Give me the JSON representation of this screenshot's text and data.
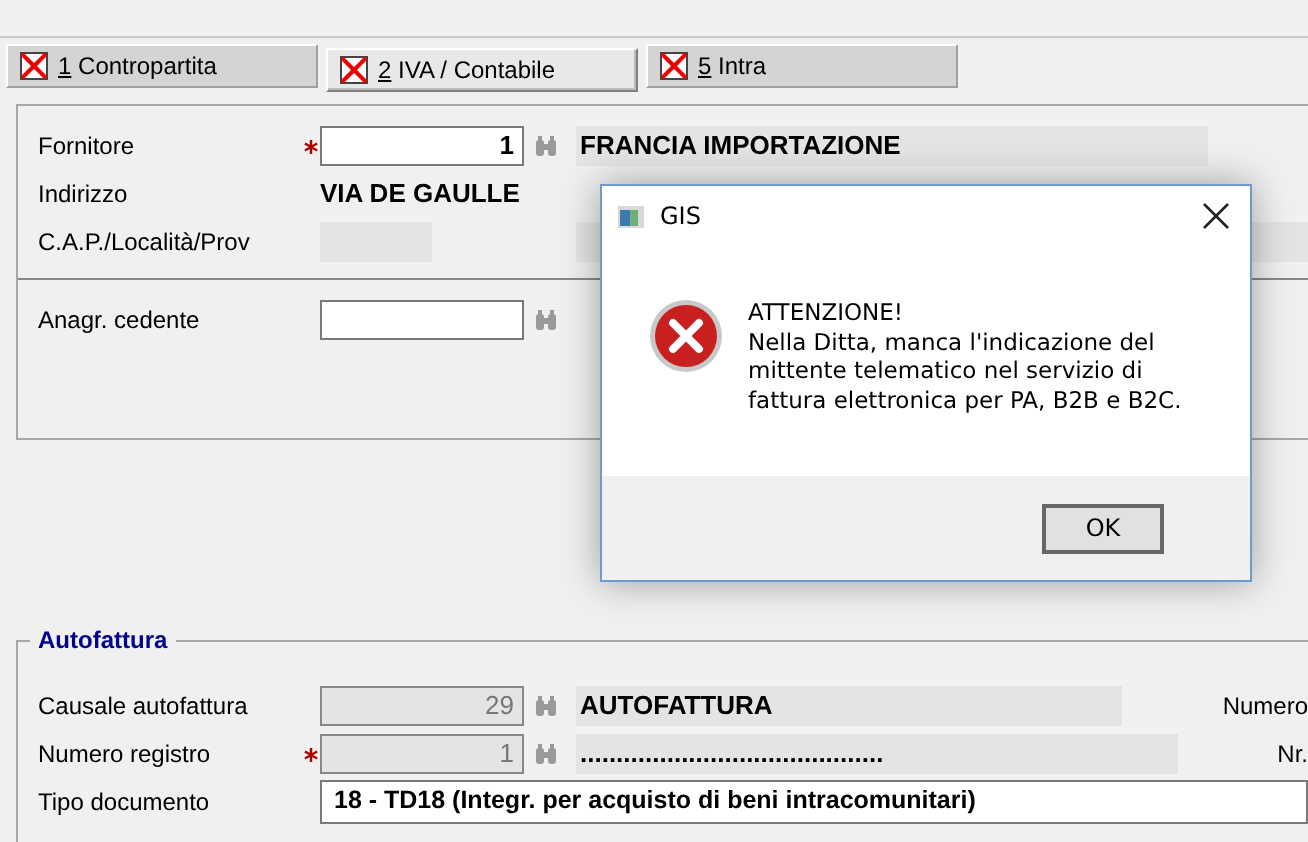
{
  "tabs": [
    {
      "key": "1",
      "label": "Contropartita",
      "selected": false
    },
    {
      "key": "2",
      "label": "IVA / Contabile",
      "selected": true
    },
    {
      "key": "5",
      "label": "Intra",
      "selected": false
    }
  ],
  "supplier_section": {
    "rows": [
      {
        "kind": "lookup",
        "label": "Fornitore",
        "required": true,
        "disabled": false,
        "code": "1",
        "value": "FRANCIA IMPORTAZIONE"
      },
      {
        "kind": "text",
        "label": "Indirizzo",
        "value": "VIA DE GAULLE"
      },
      {
        "kind": "blank",
        "label": "C.A.P./Località/Prov"
      }
    ],
    "cedente": {
      "kind": "lookup",
      "label": "Anagr. cedente",
      "required": false,
      "disabled": false
    }
  },
  "autofattura": {
    "title": "Autofattura",
    "rows": [
      {
        "kind": "lookup",
        "label": "Causale autofattura",
        "required": false,
        "disabled": true,
        "code": "29",
        "value": "AUTOFATTURA",
        "right_label": "Numero"
      },
      {
        "kind": "lookup",
        "label": "Numero registro",
        "required": true,
        "disabled": true,
        "code": "1",
        "value": "..........................................",
        "right_label": "Nr."
      },
      {
        "kind": "combo",
        "label": "Tipo documento",
        "value": "18 - TD18 (Integr. per acquisto di beni intracomunitari)"
      }
    ]
  },
  "dialog": {
    "title": "GIS",
    "heading": "ATTENZIONE!",
    "message": "Nella Ditta, manca l'indicazione del mittente telematico nel servizio di fattura elettronica per PA, B2B e B2C.",
    "button": "OK"
  }
}
